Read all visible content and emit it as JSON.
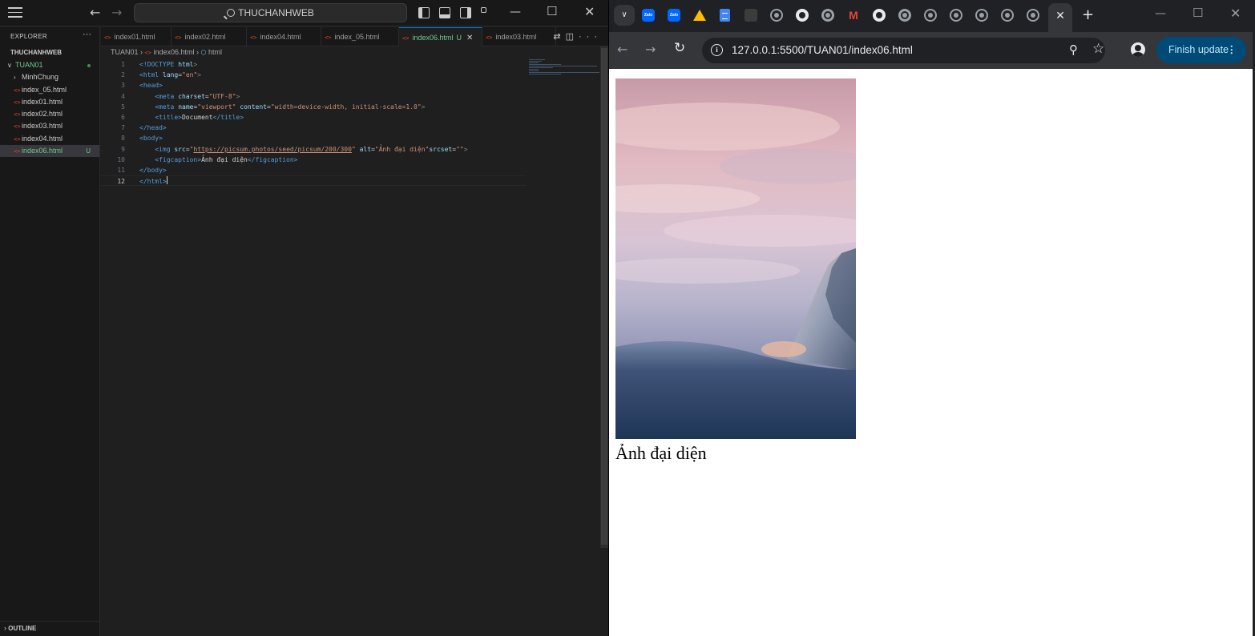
{
  "vscode": {
    "command_center": "THUCHANHWEB",
    "explorer": {
      "header": "EXPLORER",
      "workspace": "THUCHANHWEB",
      "folder": "TUAN01",
      "items": [
        {
          "label": "MinhChung",
          "type": "folder"
        },
        {
          "label": "index_05.html",
          "type": "file"
        },
        {
          "label": "index01.html",
          "type": "file"
        },
        {
          "label": "index02.html",
          "type": "file"
        },
        {
          "label": "index03.html",
          "type": "file"
        },
        {
          "label": "index04.html",
          "type": "file"
        },
        {
          "label": "index06.html",
          "type": "file",
          "badge": "U",
          "active": true
        }
      ],
      "outline": "OUTLINE"
    },
    "tabs": [
      {
        "label": "index01.html"
      },
      {
        "label": "index02.html"
      },
      {
        "label": "index04.html"
      },
      {
        "label": "index_05.html"
      },
      {
        "label": "index06.html",
        "badge": "U",
        "active": true
      },
      {
        "label": "index03.html"
      }
    ],
    "breadcrumb": {
      "folder": "TUAN01",
      "file": "index06.html",
      "symbol": "html"
    },
    "code": {
      "l1_doctype": "<!DOCTYPE",
      "l1_html": "html",
      "l2_tag": "<html",
      "l2_attr": "lang",
      "l2_val": "\"en\"",
      "l3_tag": "<head>",
      "l4_tag": "<meta",
      "l4_attr": "charset",
      "l4_val": "\"UTF-8\"",
      "l5_tag": "<meta",
      "l5_attr1": "name",
      "l5_val1": "\"viewport\"",
      "l5_attr2": "content",
      "l5_val2": "\"width=device-width, initial-scale=1.0\"",
      "l6_open": "<title>",
      "l6_text": "Document",
      "l6_close": "</title>",
      "l7_tag": "</head>",
      "l8_tag": "<body>",
      "l9_tag": "<img",
      "l9_attr1": "src",
      "l9_url": "https://picsum.photos/seed/picsum/200/300",
      "l9_attr2": "alt",
      "l9_alt": "\"Ảnh đại diện\"",
      "l9_attr3": "srcset",
      "l9_val3": "\"\"",
      "l10_open": "<figcaption>",
      "l10_text": "Ảnh đại diện",
      "l10_close": "</figcaption>",
      "l11_tag": "</body>",
      "l12_tag": "</html>"
    }
  },
  "chrome": {
    "address": "127.0.0.1:5500/TUAN01/index06.html",
    "update_button": "Finish update",
    "page": {
      "caption": "Ảnh đại diện",
      "image_alt": "Ảnh đại diện"
    }
  }
}
